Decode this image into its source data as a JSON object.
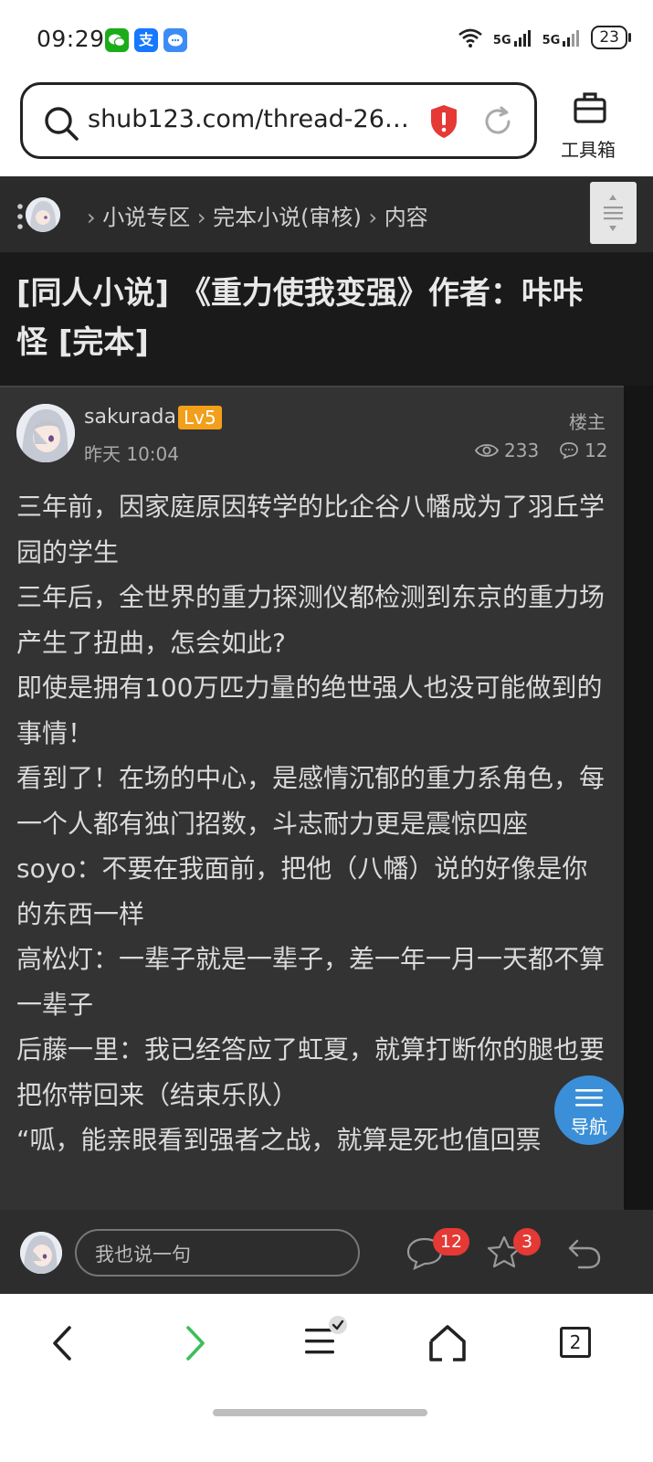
{
  "status_bar": {
    "time": "09:29",
    "apps": [
      {
        "icon": "wechat-icon",
        "glyph": "●",
        "color": "#1aad19"
      },
      {
        "icon": "alipay-icon",
        "glyph": "支",
        "color": "#1677ff"
      },
      {
        "icon": "message-icon",
        "glyph": "…",
        "color": "#3d8cf5"
      }
    ],
    "network_1": "5G",
    "network_2": "5G",
    "battery": "23"
  },
  "address_bar": {
    "url": "shub123.com/thread-26…",
    "toolbox_label": "工具箱"
  },
  "breadcrumb": [
    "小说专区",
    "完本小说(审核)",
    "内容"
  ],
  "thread": {
    "title": "[同人小说] 《重力使我变强》作者：咔咔怪 [完本]",
    "author": "sakurada",
    "level": "Lv5",
    "time": "昨天 10:04",
    "role": "楼主",
    "views": "233",
    "replies": "12",
    "body": [
      "三年前，因家庭原因转学的比企谷八幡成为了羽丘学园的学生",
      "三年后，全世界的重力探测仪都检测到东京的重力场产生了扭曲，怎会如此?",
      "即使是拥有100万匹力量的绝世强人也没可能做到的事情！",
      "看到了！在场的中心，是感情沉郁的重力系角色，每一个人都有独门招数，斗志耐力更是震惊四座",
      "soyo：不要在我面前，把他（八幡）说的好像是你的东西一样",
      "高松灯：一辈子就是一辈子，差一年一月一天都不算一辈子",
      "后藤一里：我已经答应了虹夏，就算打断你的腿也要把你带回来（结束乐队）",
      "“呱，能亲眼看到强者之战，就算是死也值回票"
    ]
  },
  "nav_button": {
    "label": "导航"
  },
  "reply_bar": {
    "placeholder": "我也说一句",
    "comment_count": "12",
    "favorite_count": "3"
  },
  "browser_bar": {
    "tab_count": "2"
  },
  "colors": {
    "page_bg": "#1a1a1a",
    "card_bg": "#333333",
    "accent_level": "#f29f1b",
    "nav_button": "#3b8fd8",
    "badge": "#e53935",
    "forward_arrow": "#3cbf5a"
  }
}
